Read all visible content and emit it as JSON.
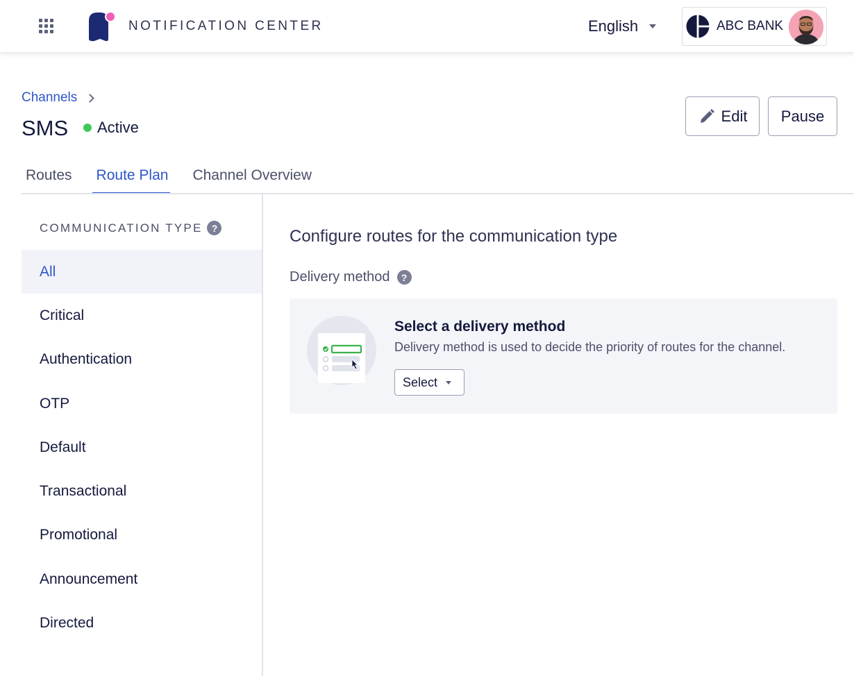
{
  "header": {
    "app_title": "NOTIFICATION CENTER",
    "language": "English",
    "org_name": "ABC BANK",
    "brand_colors": {
      "logo_body": "#1b2a72",
      "logo_dot": "#ef5fb6"
    }
  },
  "page": {
    "breadcrumb": "Channels",
    "title": "SMS",
    "status": "Active",
    "status_color": "#3ec95a",
    "actions": {
      "edit": "Edit",
      "pause": "Pause"
    }
  },
  "tabs": [
    {
      "label": "Routes",
      "active": false
    },
    {
      "label": "Route Plan",
      "active": true
    },
    {
      "label": "Channel Overview",
      "active": false
    }
  ],
  "sidebar": {
    "heading": "COMMUNICATION TYPE",
    "items": [
      {
        "label": "All",
        "active": true
      },
      {
        "label": "Critical"
      },
      {
        "label": "Authentication"
      },
      {
        "label": "OTP"
      },
      {
        "label": "Default"
      },
      {
        "label": "Transactional"
      },
      {
        "label": "Promotional"
      },
      {
        "label": "Announcement"
      },
      {
        "label": "Directed"
      }
    ]
  },
  "main": {
    "title": "Configure routes for the communication type",
    "delivery_label": "Delivery method",
    "card": {
      "title": "Select a delivery method",
      "description": "Delivery method is used to decide the priority of routes for the channel.",
      "select_value": "Select"
    }
  },
  "icons": {
    "apps": "grid-icon",
    "help": "question-circle-icon",
    "edit": "pencil-icon",
    "breadcrumb": "chevron-right-icon",
    "dropdown": "caret-down-icon"
  },
  "accent_color": "#2f56c9"
}
